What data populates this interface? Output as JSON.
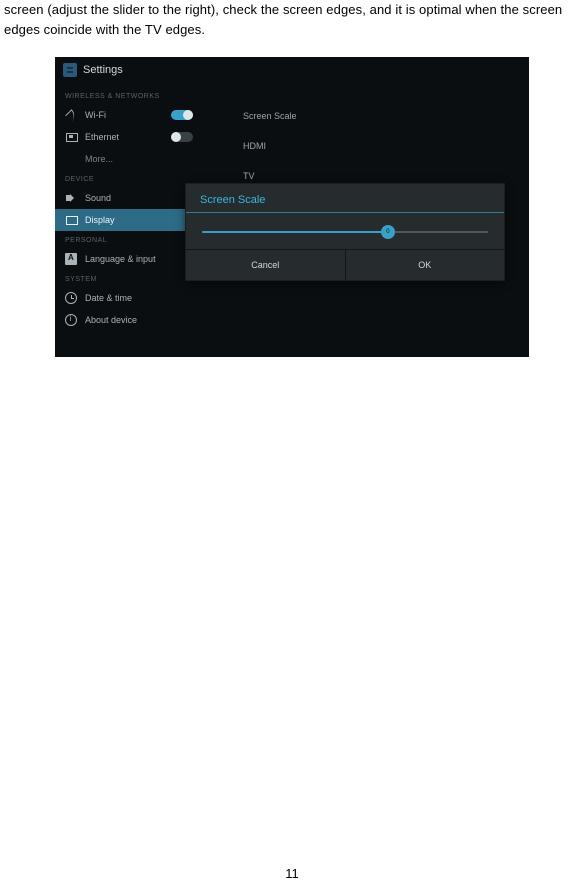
{
  "doc": {
    "paragraph": "screen (adjust the slider to the right), check the screen edges, and it is optimal when the screen edges coincide with the TV edges.",
    "page_number": "11"
  },
  "ui": {
    "titlebar": {
      "label": "Settings"
    },
    "sections": {
      "wireless": {
        "header": "WIRELESS & NETWORKS",
        "wifi_label": "Wi-Fi",
        "ethernet_label": "Ethernet",
        "more_label": "More..."
      },
      "device": {
        "header": "DEVICE",
        "sound_label": "Sound",
        "display_label": "Display"
      },
      "personal": {
        "header": "PERSONAL",
        "language_label": "Language & input"
      },
      "system": {
        "header": "SYSTEM",
        "datetime_label": "Date & time",
        "about_label": "About device"
      }
    },
    "content": {
      "screen_scale": "Screen Scale",
      "hdmi": "HDMI",
      "tv": "TV"
    },
    "modal": {
      "title": "Screen Scale",
      "slider_value": "0",
      "cancel": "Cancel",
      "ok": "OK"
    }
  }
}
